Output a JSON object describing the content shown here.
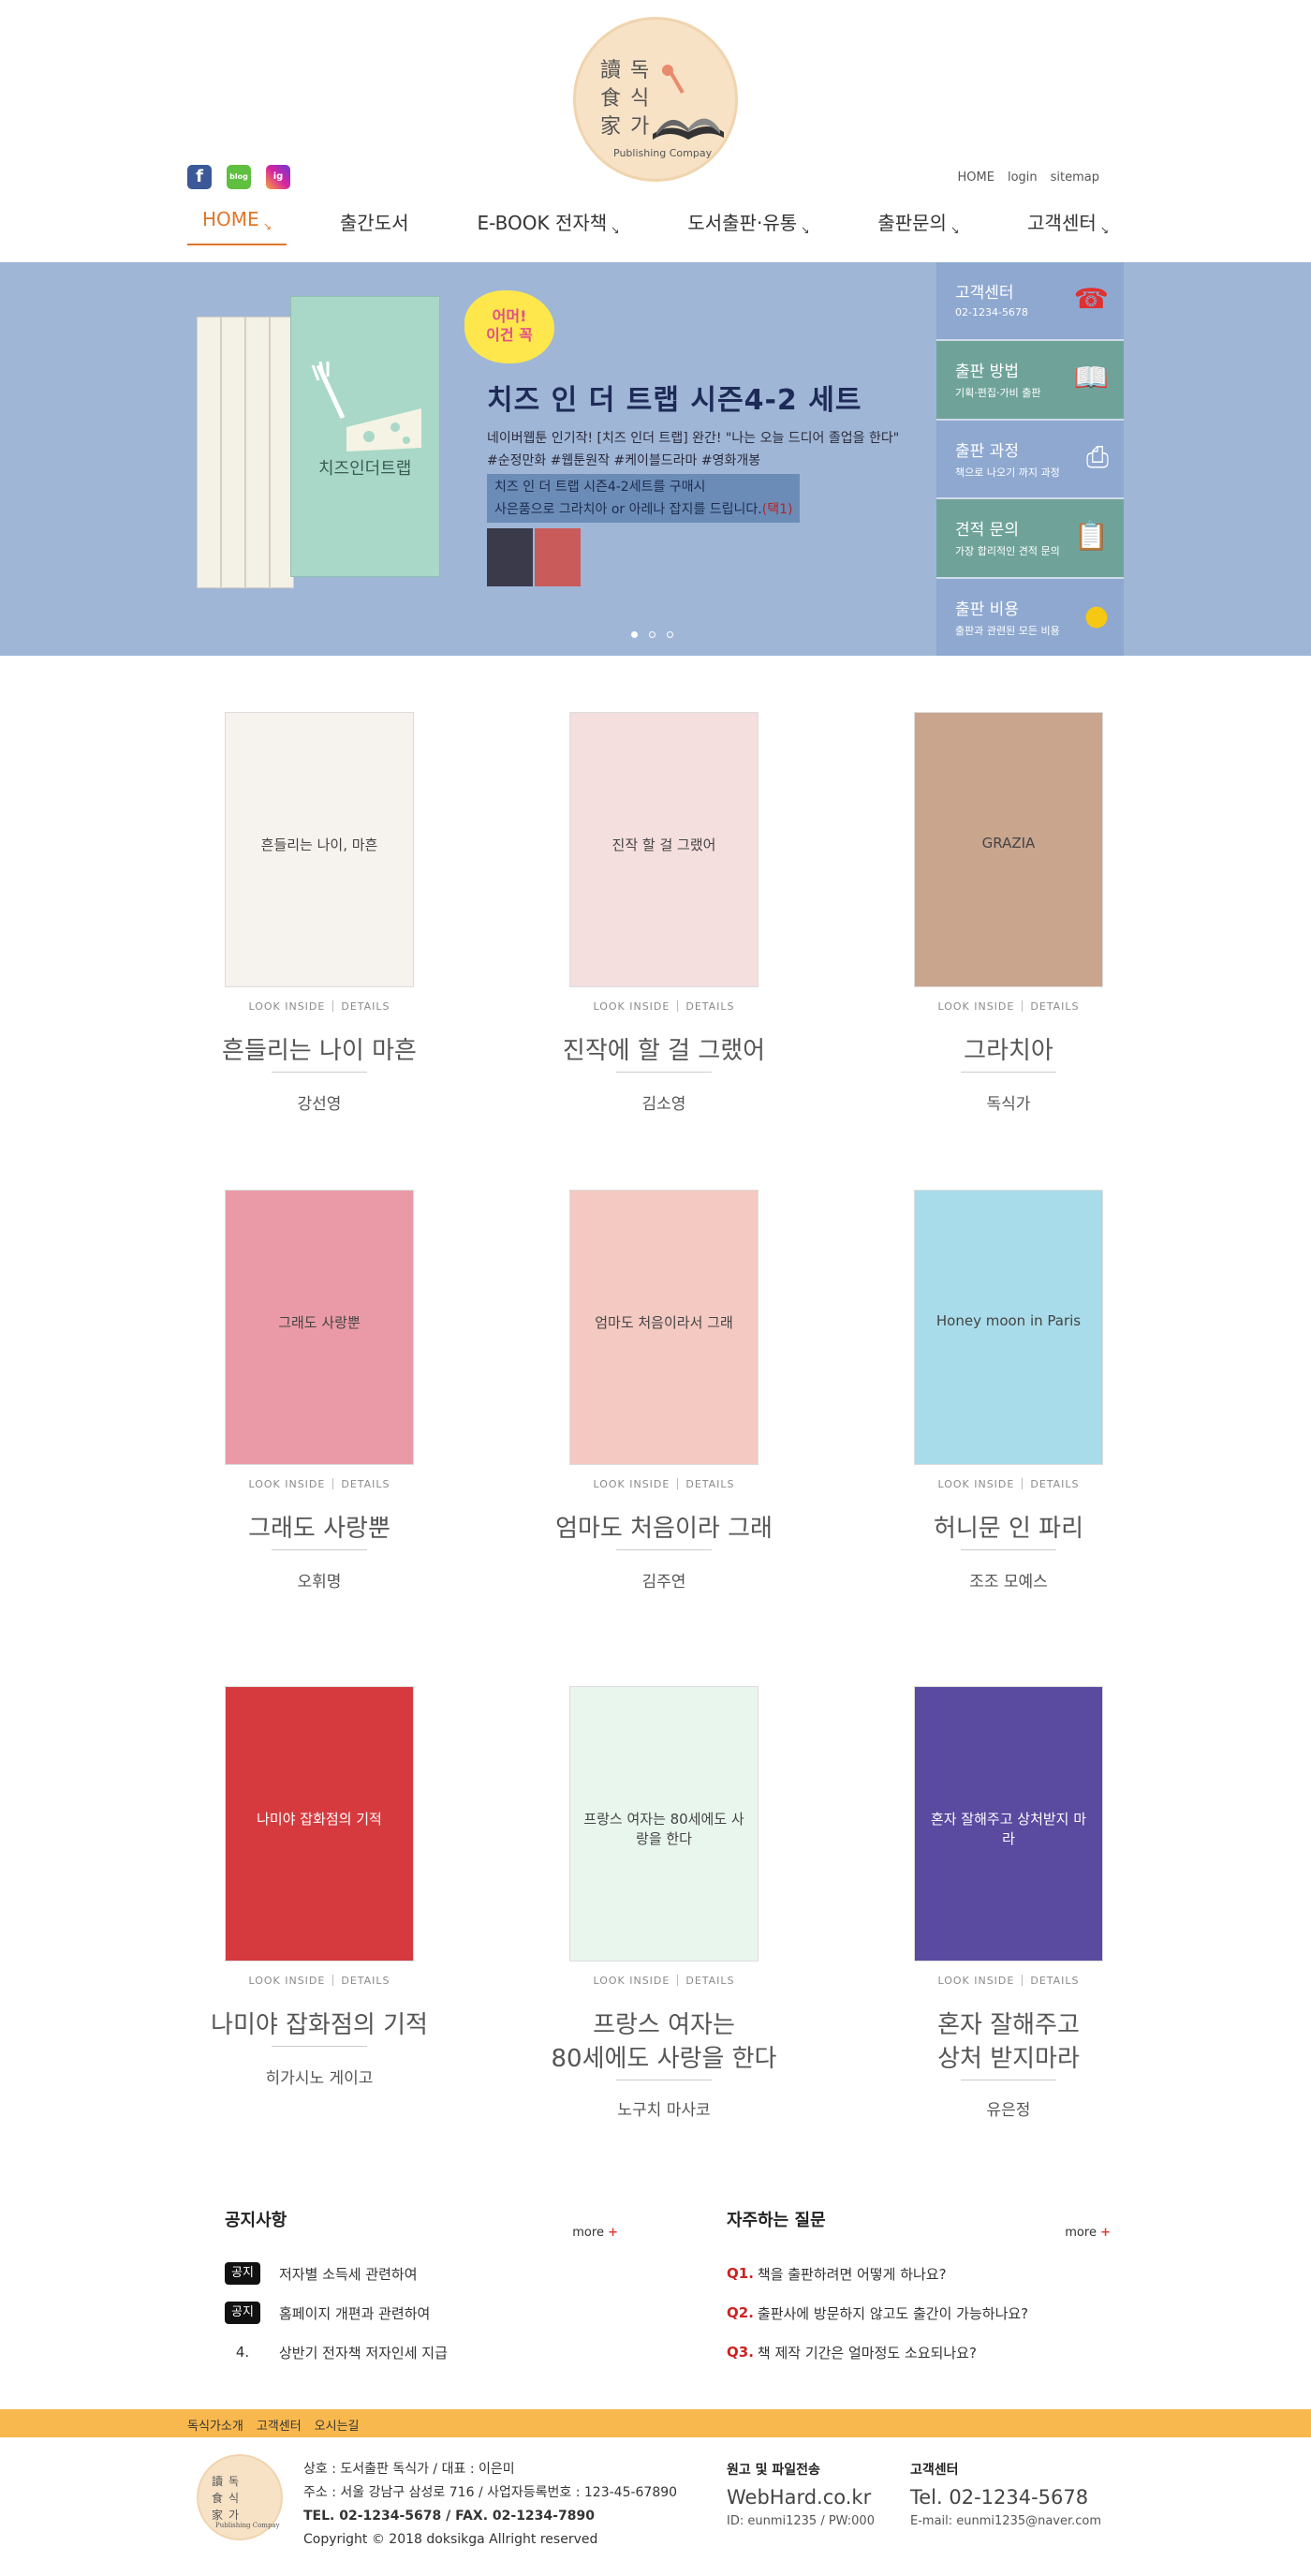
{
  "logo": {
    "hanja": "讀食家",
    "hangul": "독식가",
    "sub": "Publishing Compay"
  },
  "sns": [
    "f",
    "blog",
    "ig"
  ],
  "toplinks": [
    "HOME",
    "login",
    "sitemap"
  ],
  "nav": [
    "HOME",
    "출간도서",
    "E-BOOK 전자책",
    "도서출판·유통",
    "출판문의",
    "고객센터"
  ],
  "banner": {
    "bubble": [
      "어머!",
      "이건 꼭"
    ],
    "book_title": "치즈인더트랩",
    "title": "치즈 인 더 트랩 시즌4-2 세트",
    "desc1": "네이버웹툰 인기작! [치즈 인더 트랩] 완간! \"나는 오늘 드디어 졸업을 한다\"",
    "desc2": "#순정만화 #웹툰원작 #케이블드라마 #영화개봉",
    "hl1": "치즈 인 더 트랩 시즌4-2세트를 구매시",
    "hl2a": "사은품으로 그라치아 or 아레나 잡지를 드립니다.",
    "hl2b": "(택1)",
    "quick": [
      {
        "title": "고객센터",
        "sub": "02-1234-5678",
        "icon": "phone-icon"
      },
      {
        "title": "출판 방법",
        "sub": "기획·편집·가비 출판",
        "icon": "book-open-icon"
      },
      {
        "title": "출판 과정",
        "sub": "책으로 나오기 까지 과정",
        "icon": "printer-icon"
      },
      {
        "title": "견적 문의",
        "sub": "가장 합리적인 견적 문의",
        "icon": "clipboard-icon"
      },
      {
        "title": "출판 비용",
        "sub": "출판과 관련된 모든 비용",
        "icon": "coin-icon"
      }
    ]
  },
  "look_inside": "LOOK INSIDE",
  "details": "DETAILS",
  "books": [
    {
      "title": "흔들리는 나이 마흔",
      "author": "강선영",
      "cover": "흔들리는 나이, 마흔",
      "bg": "#f6f2ee"
    },
    {
      "title": "진작에 할 걸 그랬어",
      "author": "김소영",
      "cover": "진작 할 걸 그랬어",
      "bg": "#f5dede"
    },
    {
      "title": "그라치아",
      "author": "독식가",
      "cover": "GRAZIA",
      "bg": "#c9a58e"
    },
    {
      "title": "그래도 사랑뿐",
      "author": "오휘명",
      "cover": "그래도 사랑뿐",
      "bg": "#ea9aa6"
    },
    {
      "title": "엄마도 처음이라 그래",
      "author": "김주연",
      "cover": "엄마도 처음이라서 그래",
      "bg": "#f3c9c2"
    },
    {
      "title": "허니문 인 파리",
      "author": "조조 모예스",
      "cover": "Honey moon in Paris",
      "bg": "#a9dcea"
    },
    {
      "title": "나미야 잡화점의 기적",
      "author": "히가시노 게이고",
      "cover": "나미야 잡화점의 기적",
      "bg": "#d63a3e"
    },
    {
      "title": "프랑스 여자는\n80세에도 사랑을 한다",
      "author": "노구치 마사코",
      "cover": "프랑스 여자는 80세에도 사랑을 한다",
      "bg": "#e9f6ee"
    },
    {
      "title": "혼자 잘해주고\n상처 받지마라",
      "author": "유은정",
      "cover": "혼자 잘해주고 상처받지 마라",
      "bg": "#5a4aa0"
    }
  ],
  "notice": {
    "title": "공지사항",
    "more": "more",
    "plus": "+",
    "items": [
      {
        "tag": "공지",
        "text": "저자별 소득세 관련하여"
      },
      {
        "tag": "공지",
        "text": "홈페이지 개편과 관련하여"
      },
      {
        "tag": "4.",
        "text": "상반기 전자책 저자인세 지급"
      }
    ]
  },
  "faq": {
    "title": "자주하는 질문",
    "more": "more",
    "plus": "+",
    "items": [
      {
        "q": "Q1.",
        "text": "책을 출판하려면 어떻게 하나요?"
      },
      {
        "q": "Q2.",
        "text": "출판사에 방문하지 않고도 출간이 가능하나요?"
      },
      {
        "q": "Q3.",
        "text": "책 제작 기간은 얼마정도 소요되나요?"
      }
    ]
  },
  "footer": {
    "links": [
      "독식가소개",
      "고객센터",
      "오시는길"
    ],
    "line1": "상호 : 도서출판 독식가   /  대표 : 이은미",
    "line2": "주소 : 서울 강남구 삼성로 716   /  사업자등록번호 : 123-45-67890",
    "line3": "TEL. 02-1234-5678   /  FAX. 02-1234-7890",
    "line4": "Copyright © 2018 doksikga Allright reserved",
    "upload_title": "원고 및 파일전송",
    "upload_url": "WebHard.co.kr",
    "upload_id": "ID: eunmi1235 / PW:000",
    "cs_title": "고객센터",
    "cs_tel": "Tel. 02-1234-5678",
    "cs_mail": "E-mail: eunmi1235@naver.com"
  },
  "colors": {
    "accent": "#e0762a",
    "banner": "#9fb6d6",
    "footer_bar": "#f8b84e"
  }
}
